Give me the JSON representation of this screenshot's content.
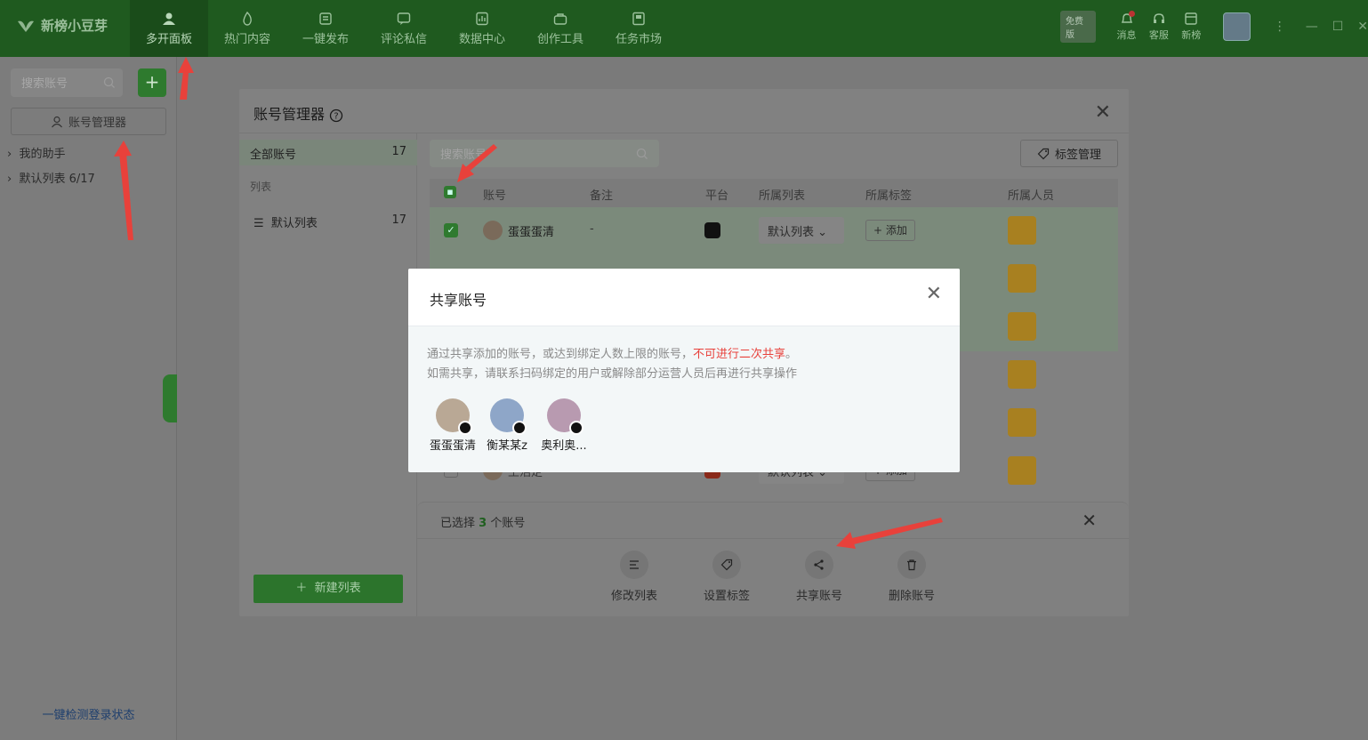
{
  "app": {
    "name": "新榜小豆芽"
  },
  "nav": [
    {
      "label": "多开面板",
      "icon": "user-icon"
    },
    {
      "label": "热门内容",
      "icon": "fire-icon"
    },
    {
      "label": "一键发布",
      "icon": "publish-icon"
    },
    {
      "label": "评论私信",
      "icon": "message-icon"
    },
    {
      "label": "数据中心",
      "icon": "data-icon"
    },
    {
      "label": "创作工具",
      "icon": "toolbox-icon"
    },
    {
      "label": "任务市场",
      "icon": "task-icon"
    }
  ],
  "toolbar": {
    "version_badge": "免费版",
    "messages": "消息",
    "service": "客服",
    "news": "新榜"
  },
  "left": {
    "search_placeholder": "搜索账号",
    "manager_button": "账号管理器",
    "tree": [
      {
        "label": "我的助手"
      },
      {
        "label": "默认列表 6/17"
      }
    ],
    "footer": "一键检测登录状态"
  },
  "manager": {
    "title": "账号管理器",
    "side": {
      "all_label": "全部账号",
      "all_count": "17",
      "caption": "列表",
      "default_label": "默认列表",
      "default_count": "17",
      "new_list": "新建列表"
    },
    "search_placeholder": "搜索账号",
    "tag_manage": "标签管理",
    "columns": [
      "账号",
      "备注",
      "平台",
      "所属列表",
      "所属标签",
      "所属人员"
    ],
    "rows": [
      {
        "name": "蛋蛋蛋清",
        "note": "-",
        "list": "默认列表",
        "tag": "+ 添加"
      },
      {
        "name": "王浩定",
        "note": "...",
        "list": "默认列表",
        "tag": "+ 添加"
      }
    ],
    "selection": {
      "prefix": "已选择",
      "count": "3",
      "suffix": "个账号"
    },
    "actions": [
      "修改列表",
      "设置标签",
      "共享账号",
      "删除账号"
    ]
  },
  "share_modal": {
    "title": "共享账号",
    "desc_line1": "通过共享添加的账号，或达到绑定人数上限的账号，",
    "desc_warn": "不可进行二次共享",
    "desc_line1_end": "。",
    "desc_line2": "如需共享，请联系扫码绑定的用户或解除部分运营人员后再进行共享操作",
    "accounts": [
      {
        "name": "蛋蛋蛋清"
      },
      {
        "name": "衡某某z"
      },
      {
        "name": "奥利奥..."
      }
    ]
  },
  "colors": {
    "brand": "#2e7d32",
    "warn": "#e8413b",
    "annotation": "#e8413b"
  }
}
